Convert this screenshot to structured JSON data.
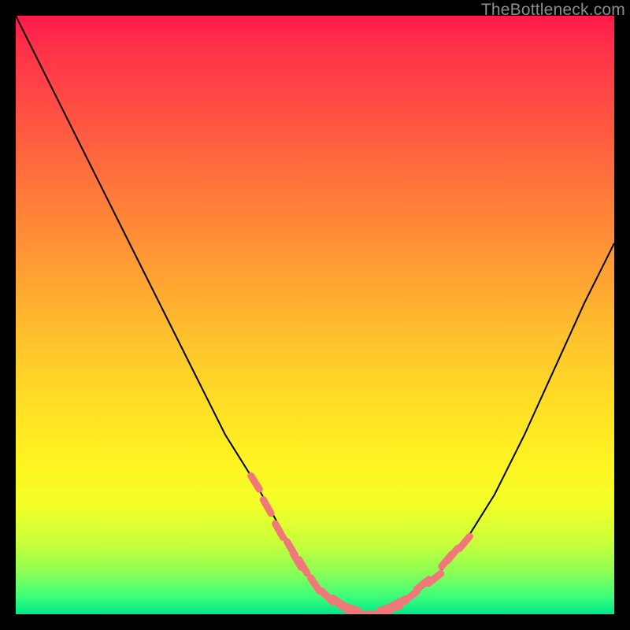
{
  "watermark": "TheBottleneck.com",
  "colors": {
    "page_background": "#000000",
    "curve_stroke": "#000000",
    "marker_fill": "#f07878",
    "gradient_stops": [
      "#ff1a4d",
      "#ff3349",
      "#ff5642",
      "#ff7a3a",
      "#ff9d33",
      "#ffc22c",
      "#ffe126",
      "#fff421",
      "#f2ff28",
      "#c9ff3a",
      "#8cff55",
      "#3dff7a",
      "#00e68a"
    ]
  },
  "chart_data": {
    "type": "line",
    "title": "",
    "xlabel": "",
    "ylabel": "",
    "xlim": [
      0,
      100
    ],
    "ylim": [
      0,
      100
    ],
    "grid": false,
    "series": [
      {
        "name": "bottleneck-curve",
        "x": [
          0,
          5,
          10,
          15,
          20,
          25,
          30,
          35,
          40,
          45,
          48,
          50,
          52,
          55,
          58,
          60,
          63,
          65,
          70,
          75,
          80,
          85,
          90,
          95,
          100
        ],
        "y": [
          100,
          90,
          80,
          70,
          60,
          50,
          40,
          30,
          22,
          13,
          8,
          5,
          3,
          1,
          0,
          0,
          1,
          2,
          6,
          12,
          20,
          30,
          41,
          52,
          62
        ]
      }
    ],
    "markers": [
      {
        "name": "cluster-left",
        "x": [
          40,
          42,
          44,
          46,
          47,
          48,
          50,
          52,
          54,
          56,
          58,
          60,
          62
        ],
        "y": [
          22,
          18,
          14,
          11,
          9,
          8,
          5,
          3,
          2,
          1,
          0,
          0,
          1
        ]
      },
      {
        "name": "cluster-floor",
        "x": [
          55,
          57,
          59,
          61,
          63
        ],
        "y": [
          1,
          0,
          0,
          0,
          1
        ]
      },
      {
        "name": "cluster-right",
        "x": [
          64,
          66,
          68,
          70,
          72,
          73,
          75
        ],
        "y": [
          2,
          3,
          5,
          6,
          9,
          10,
          12
        ]
      }
    ]
  }
}
